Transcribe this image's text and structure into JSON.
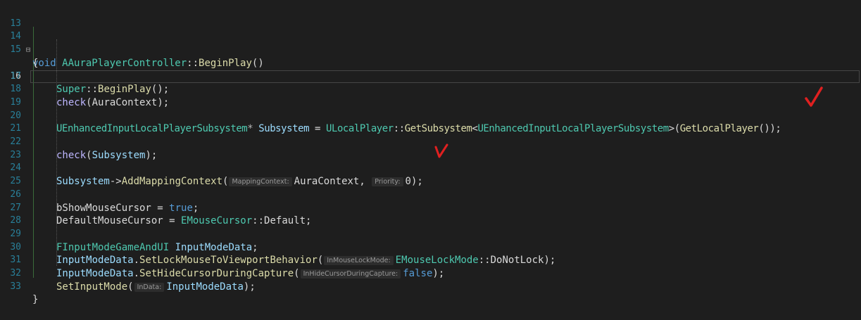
{
  "editor": {
    "line_numbers": [
      "13",
      "14",
      "15",
      "16",
      "17",
      "18",
      "19",
      "20",
      "21",
      "22",
      "23",
      "24",
      "25",
      "26",
      "27",
      "28",
      "29",
      "30",
      "31",
      "32",
      "33"
    ],
    "current_line": "16",
    "fold_glyph": "⊟",
    "header": {
      "keyword": "void",
      "class_name": "AAuraPlayerController",
      "scope": "::",
      "method": "BeginPlay",
      "parens": "()"
    },
    "open_brace": "{",
    "close_brace": "}",
    "l16": {
      "super": "Super",
      "scope": "::",
      "fn": "BeginPlay",
      "rest": "();"
    },
    "l18": {
      "macro": "check",
      "open": "(",
      "arg": "AuraContext",
      "close": ");"
    },
    "l20": {
      "type": "UEnhancedInputLocalPlayerSubsystem",
      "ptr": "*",
      "var": "Subsystem",
      "eq": " = ",
      "cls": "ULocalPlayer",
      "scope": "::",
      "fn": "GetSubsystem",
      "lt": "<",
      "targ": "UEnhancedInputLocalPlayerSubsystem",
      "gt": ">(",
      "fn2": "GetLocalPlayer",
      "rest": "());"
    },
    "l22": {
      "macro": "check",
      "open": "(",
      "arg": "Subsystem",
      "close": ");"
    },
    "l24": {
      "var": "Subsystem",
      "arrow": "->",
      "fn": "AddMappingContext",
      "open": "(",
      "hint1": "MappingContext:",
      "arg1": "AuraContext",
      "comma": ", ",
      "hint2": "Priority:",
      "arg2": "0",
      "close": ");"
    },
    "l26": {
      "var": "bShowMouseCursor",
      "eq": " = ",
      "val": "true",
      "end": ";"
    },
    "l27": {
      "var": "DefaultMouseCursor",
      "eq": " = ",
      "type": "EMouseCursor",
      "scope": "::",
      "val": "Default",
      "end": ";"
    },
    "l29": {
      "type": "FInputModeGameAndUI",
      "var": "InputModeData",
      "end": ";"
    },
    "l30": {
      "var": "InputModeData",
      "dot": ".",
      "fn": "SetLockMouseToViewportBehavior",
      "open": "(",
      "hint": "InMouseLockMode:",
      "type": "EMouseLockMode",
      "scope": "::",
      "val": "DoNotLock",
      "close": ");"
    },
    "l31": {
      "var": "InputModeData",
      "dot": ".",
      "fn": "SetHideCursorDuringCapture",
      "open": "(",
      "hint": "InHideCursorDuringCapture:",
      "val": "false",
      "close": ");"
    },
    "l32": {
      "fn": "SetInputMode",
      "open": "(",
      "hint": "InData:",
      "arg": "InputModeData",
      "close": ");"
    }
  },
  "annotation_color": "#e02020"
}
